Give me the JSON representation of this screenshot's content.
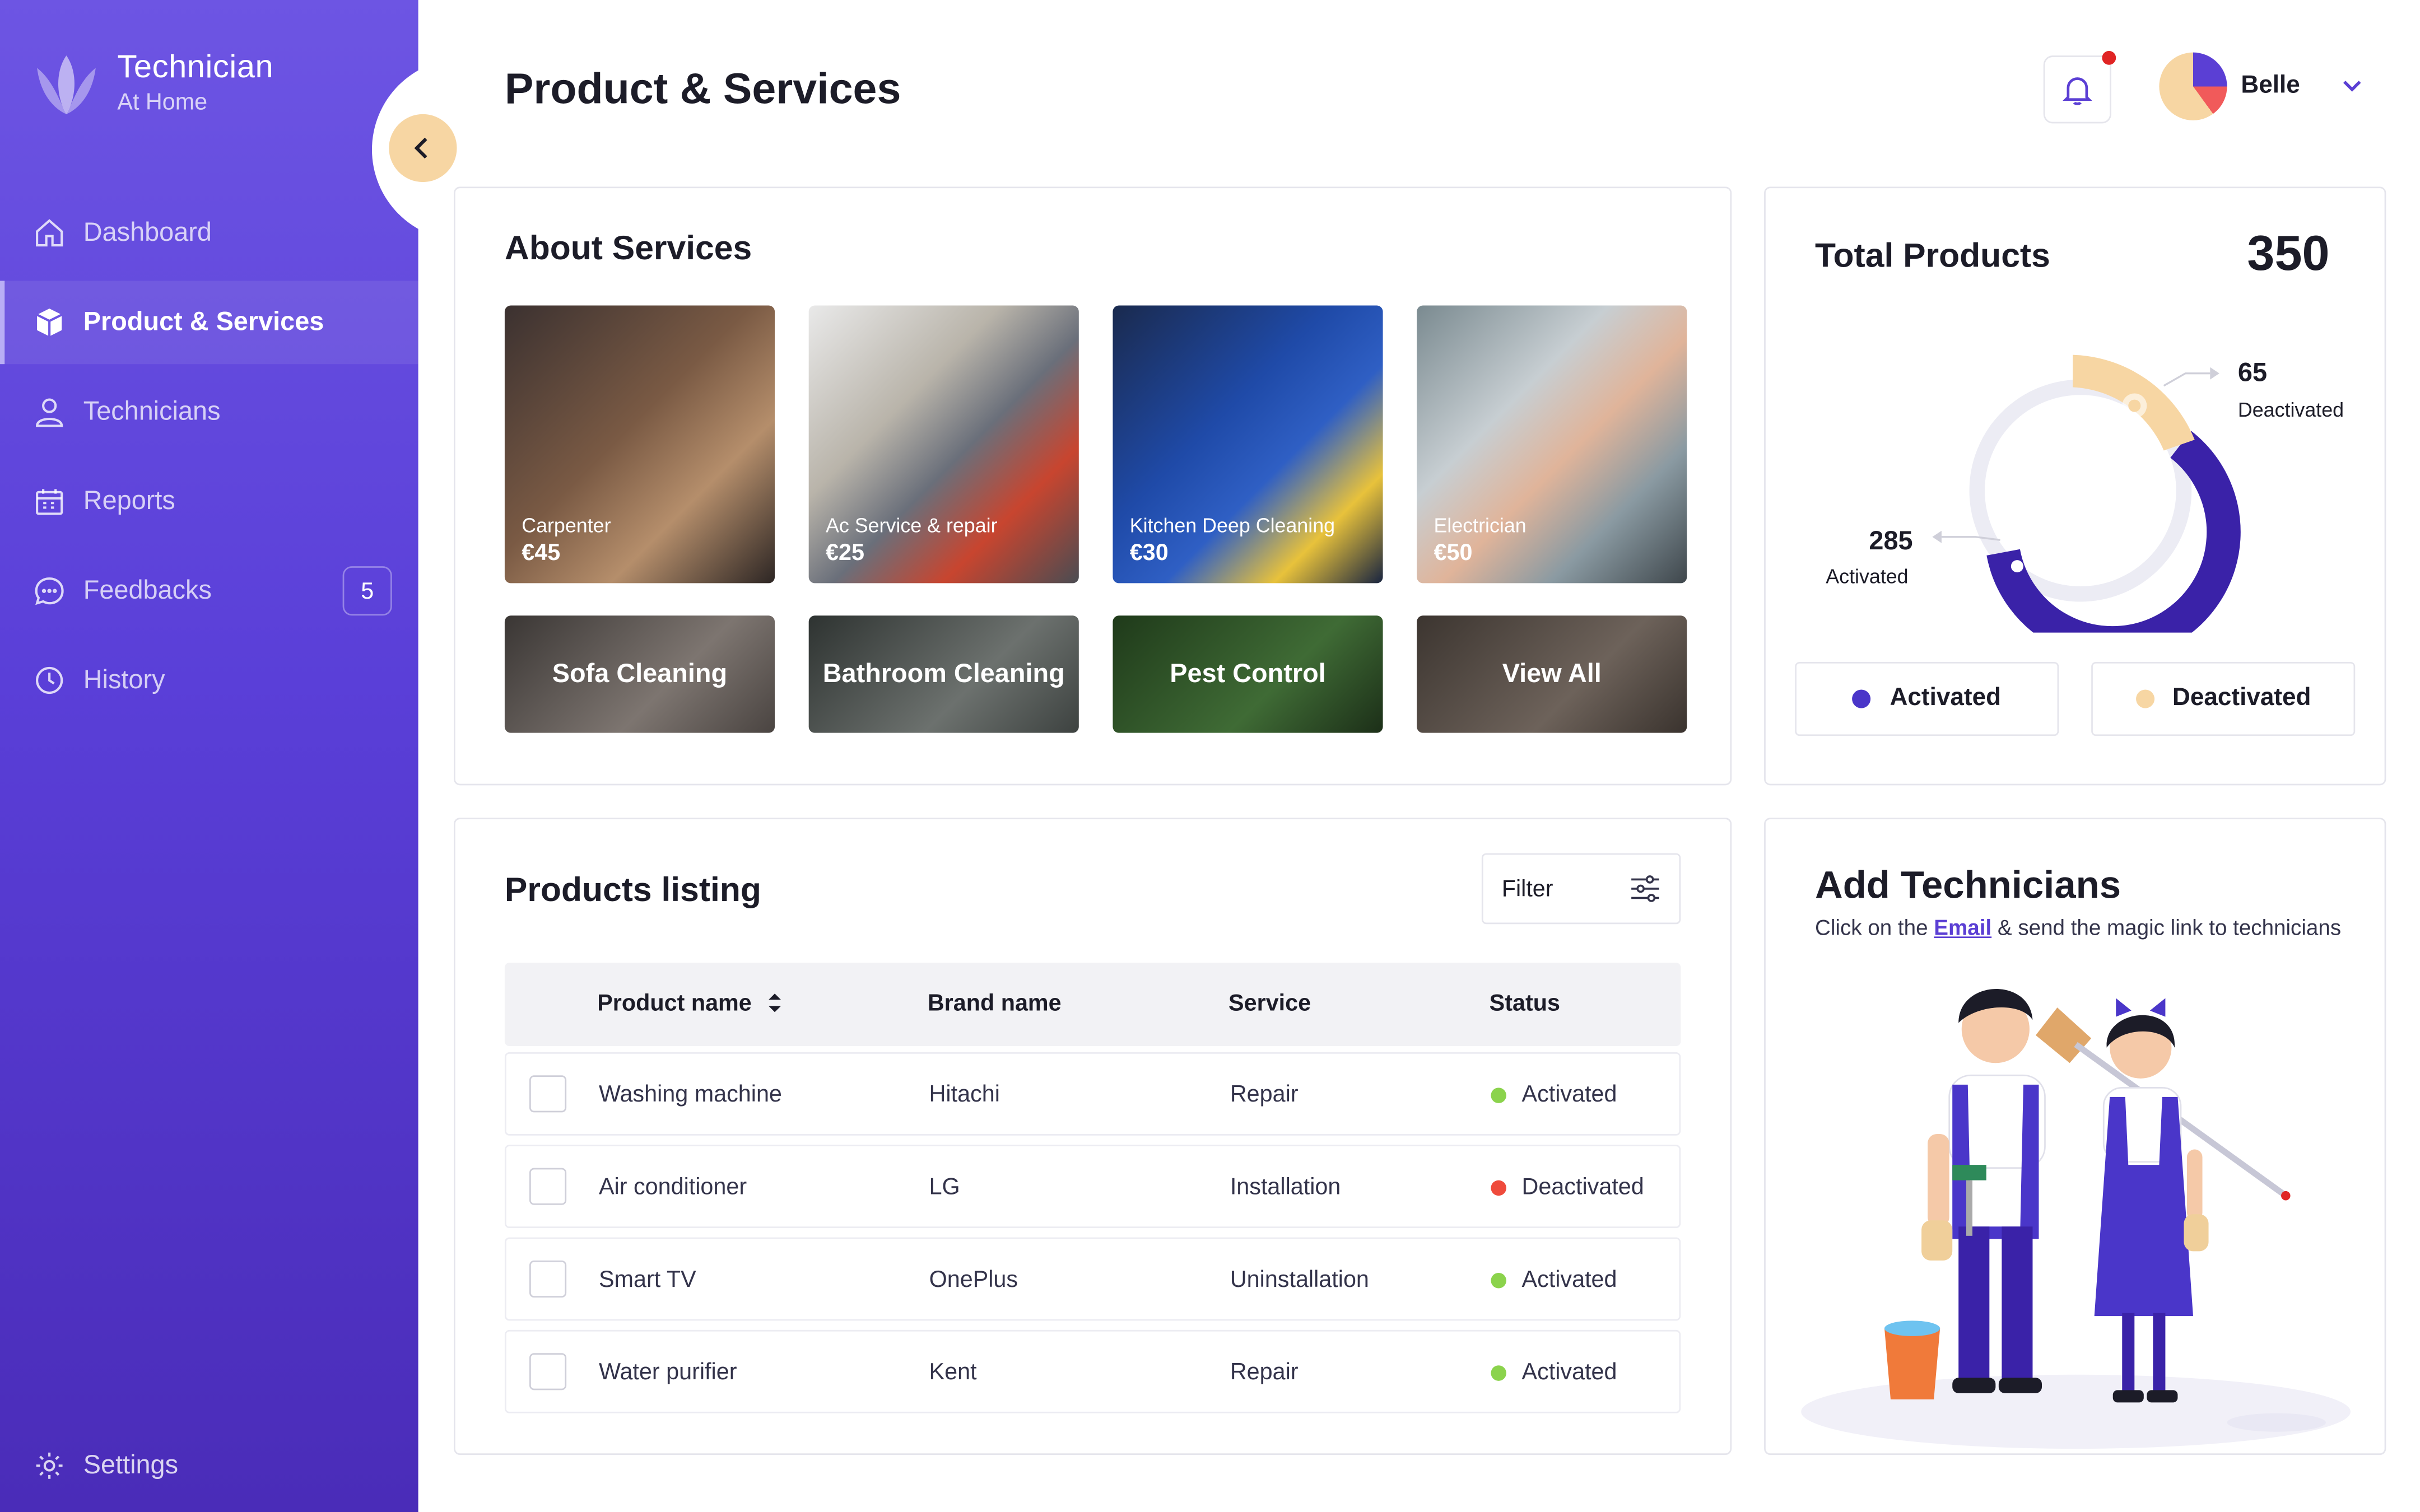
{
  "app": {
    "title": "Technician",
    "subtitle": "At Home"
  },
  "sidebar": {
    "items": [
      {
        "label": "Dashboard",
        "icon": "home-icon"
      },
      {
        "label": "Product & Services",
        "icon": "box-icon"
      },
      {
        "label": "Technicians",
        "icon": "user-icon"
      },
      {
        "label": "Reports",
        "icon": "calendar-icon"
      },
      {
        "label": "Feedbacks",
        "icon": "chat-icon",
        "badge": "5"
      },
      {
        "label": "History",
        "icon": "clock-icon"
      }
    ],
    "settings_label": "Settings"
  },
  "header": {
    "title": "Product & Services",
    "user_name": "Belle"
  },
  "about": {
    "title": "About Services",
    "services": [
      {
        "name": "Carpenter",
        "price": "€45"
      },
      {
        "name": "Ac Service & repair",
        "price": "€25"
      },
      {
        "name": "Kitchen Deep Cleaning",
        "price": "€30"
      },
      {
        "name": "Electrician",
        "price": "€50"
      }
    ],
    "more": [
      "Sofa Cleaning",
      "Bathroom Cleaning",
      "Pest Control",
      "View All"
    ]
  },
  "totals": {
    "title": "Total Products",
    "total": "350",
    "activated_value": "285",
    "activated_label": "Activated",
    "deactivated_value": "65",
    "deactivated_label": "Deactivated",
    "legend_activated": "Activated",
    "legend_deactivated": "Deactivated",
    "colors": {
      "activated": "#3a22a8",
      "deactivated": "#f7d6a3"
    }
  },
  "listing": {
    "title": "Products listing",
    "filter_label": "Filter",
    "columns": [
      "Product name",
      "Brand name",
      "Service",
      "Status"
    ],
    "rows": [
      {
        "product": "Washing machine",
        "brand": "Hitachi",
        "service": "Repair",
        "status": "Activated"
      },
      {
        "product": "Air conditioner",
        "brand": "LG",
        "service": "Installation",
        "status": "Deactivated"
      },
      {
        "product": "Smart TV",
        "brand": "OnePlus",
        "service": "Uninstallation",
        "status": "Activated"
      },
      {
        "product": "Water purifier",
        "brand": "Kent",
        "service": "Repair",
        "status": "Activated"
      }
    ],
    "status_colors": {
      "Activated": "#8bd34c",
      "Deactivated": "#ef4b3c"
    }
  },
  "add_tech": {
    "title": "Add Technicians",
    "sub_before": "Click on the",
    "sub_link": "Email",
    "sub_after": "& send the magic link to technicians"
  }
}
